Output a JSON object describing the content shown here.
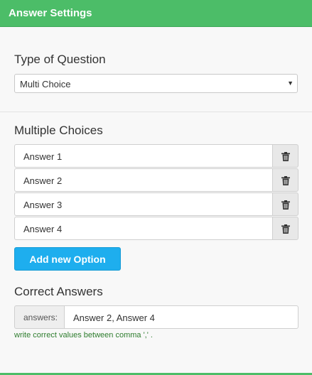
{
  "header": {
    "title": "Answer Settings"
  },
  "question_type": {
    "label": "Type of Question",
    "selected": "Multi Choice",
    "caret": "▼"
  },
  "choices": {
    "label": "Multiple Choices",
    "items": [
      {
        "value": "Answer 1"
      },
      {
        "value": "Answer 2"
      },
      {
        "value": "Answer 3"
      },
      {
        "value": "Answer 4"
      }
    ],
    "delete_icon": "trash-icon",
    "add_label": "Add new Option"
  },
  "correct": {
    "label": "Correct Answers",
    "addon": "answers:",
    "value": "Answer 2, Answer 4",
    "hint": "write correct values between comma ',' ."
  },
  "colors": {
    "header": "#4cbd68",
    "button": "#1eaeee",
    "hint": "#2e7d2e"
  }
}
